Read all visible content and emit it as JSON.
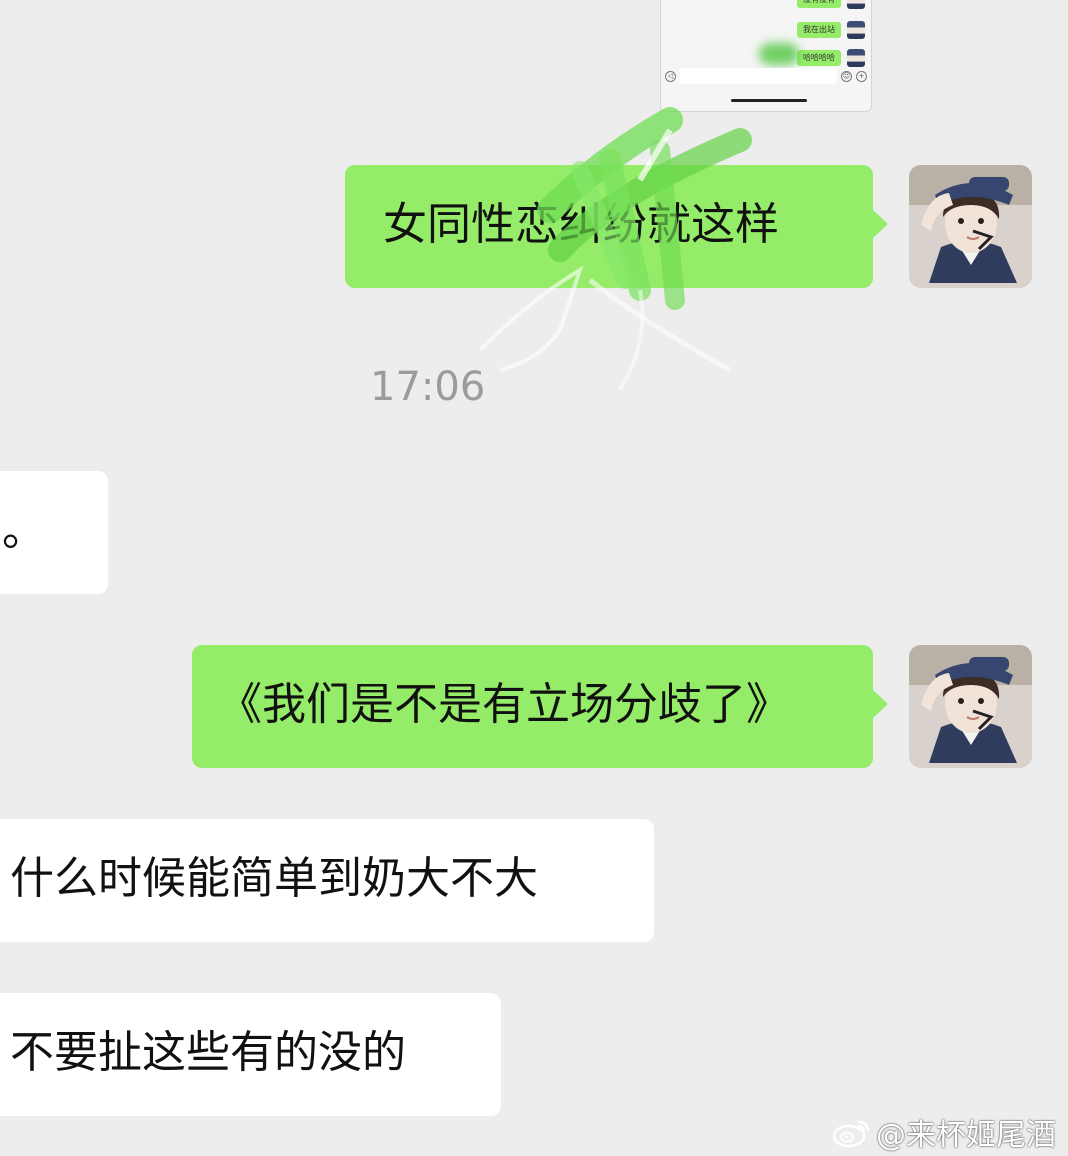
{
  "thumbnail": {
    "messages": [
      "没有没有",
      "我在出站",
      "哈哈哈哈"
    ]
  },
  "messages": [
    {
      "id": "m1",
      "side": "me",
      "text": "女同性恋纠纷就这样"
    },
    {
      "id": "m2",
      "side": "other",
      "text": "。"
    },
    {
      "id": "m3",
      "side": "me",
      "text": "《我们是不是有立场分歧了》"
    },
    {
      "id": "m4",
      "side": "other",
      "text": "什么时候能简单到奶大不大"
    },
    {
      "id": "m5",
      "side": "other",
      "text": "不要扯这些有的没的"
    }
  ],
  "timestamp": "17:06",
  "watermark": "@来杯姬尾酒",
  "colors": {
    "my_bubble": "#95ec69",
    "other_bubble": "#ffffff",
    "background": "#ededed",
    "timestamp": "#9b9b9b"
  },
  "icons": [
    "voice-icon",
    "emoji-icon",
    "plus-icon",
    "weibo-logo-icon",
    "user-avatar"
  ]
}
